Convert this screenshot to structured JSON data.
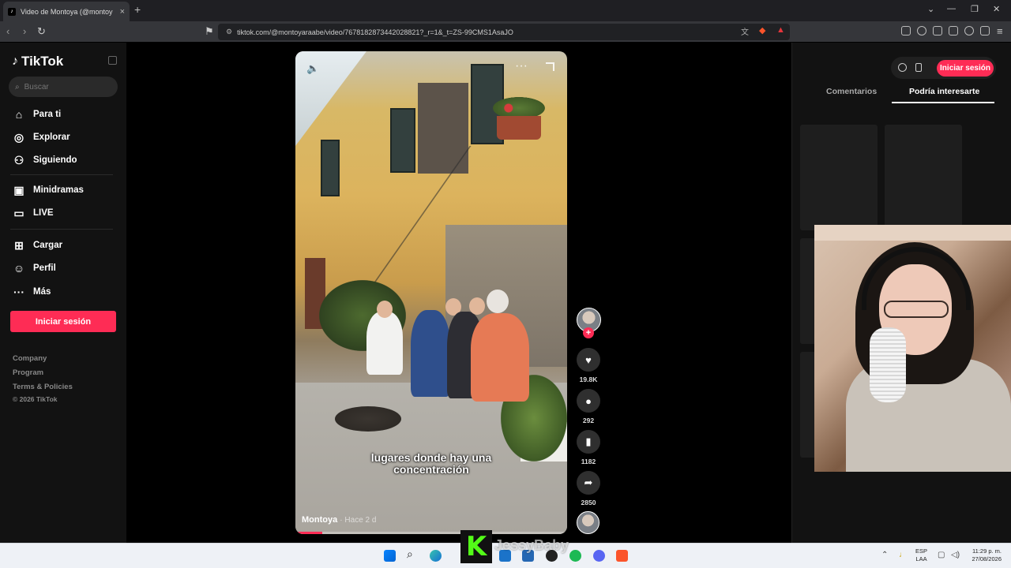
{
  "browser": {
    "tab_title": "Video de Montoya (@montoy",
    "url": "tiktok.com/@montoyaraabe/video/7678182873442028821?_r=1&_t=ZS-99CMS1AsaJO"
  },
  "sidebar": {
    "logo": "TikTok",
    "search_placeholder": "Buscar",
    "items": [
      {
        "label": "Para ti",
        "icon": "home-icon"
      },
      {
        "label": "Explorar",
        "icon": "compass-icon"
      },
      {
        "label": "Siguiendo",
        "icon": "user-follow-icon"
      },
      {
        "label": "Minidramas",
        "icon": "film-icon"
      },
      {
        "label": "LIVE",
        "icon": "tv-icon"
      },
      {
        "label": "Cargar",
        "icon": "plus-square-icon"
      },
      {
        "label": "Perfil",
        "icon": "person-icon"
      },
      {
        "label": "Más",
        "icon": "more-icon"
      }
    ],
    "login_button": "Iniciar sesión",
    "footer": [
      "Company",
      "Program",
      "Terms & Policies",
      "© 2026 TikTok"
    ]
  },
  "video": {
    "caption": "lugares donde hay una\nconcentración",
    "author": "Montoya",
    "time_ago": "· Hace 2 d",
    "progress": 0.1
  },
  "actions": {
    "likes": "19.8K",
    "comments": "292",
    "saves": "1182",
    "shares": "2850"
  },
  "right_panel": {
    "login_button": "Iniciar sesión",
    "tabs": [
      "Comentarios",
      "Podría interesarte"
    ],
    "active_tab": "Podría interesarte"
  },
  "watermark": {
    "letter": "K",
    "name": "JessyBaby"
  },
  "taskbar": {
    "lang_top": "ESP",
    "lang_bottom": "LAA",
    "time": "11:29 p. m.",
    "date": "27/08/2026"
  },
  "colors": {
    "accent": "#fe2c55",
    "kick_green": "#53fc18"
  }
}
